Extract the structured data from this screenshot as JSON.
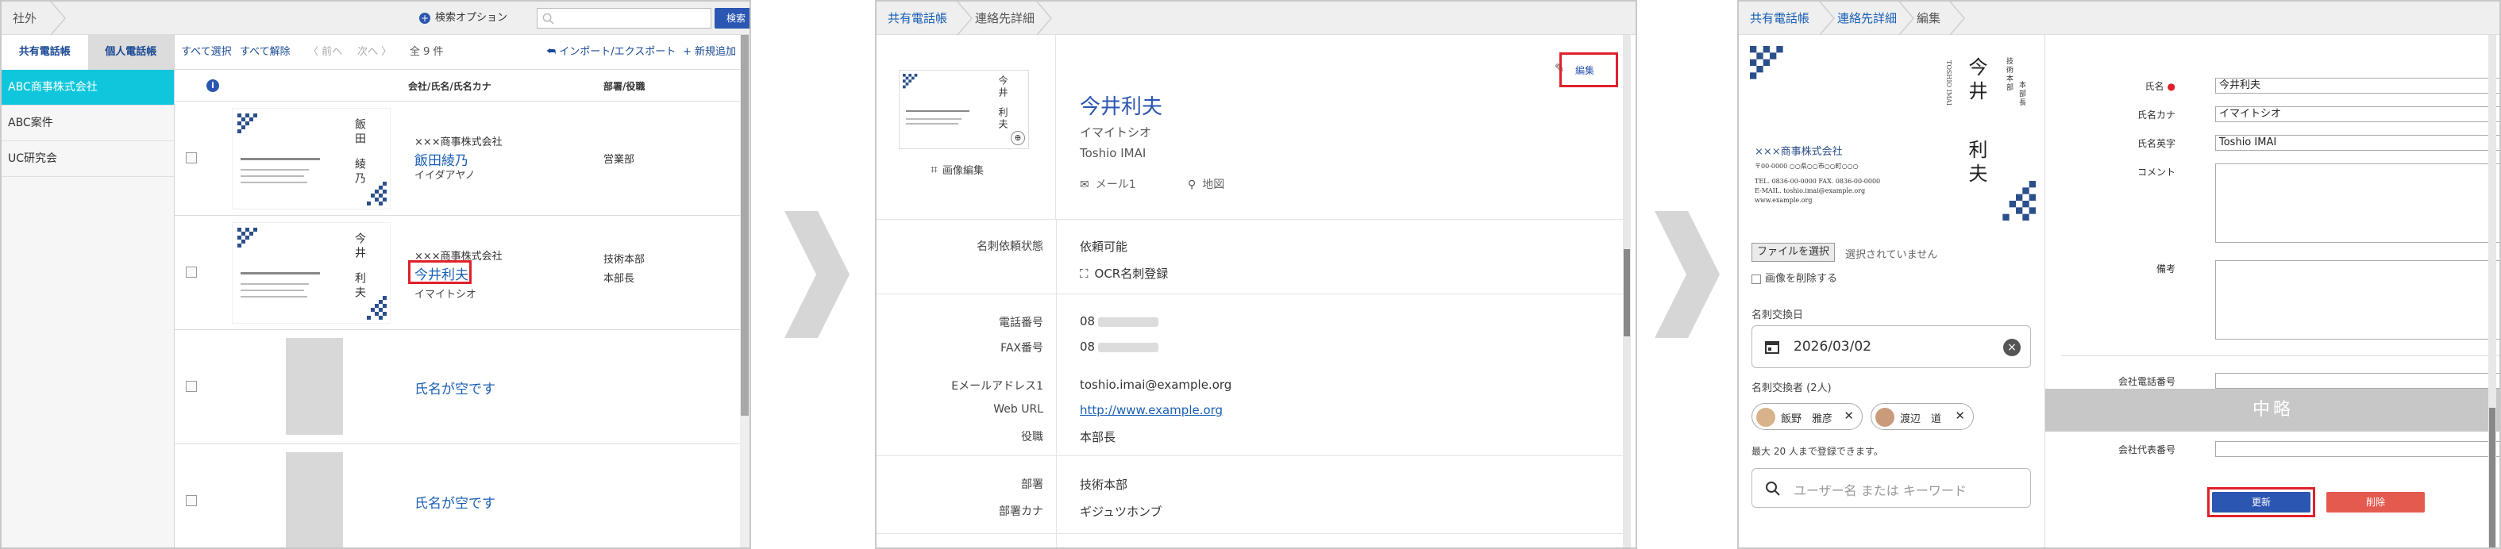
{
  "panel1": {
    "breadcrumb": "社外",
    "search_option": "検索オプション",
    "search_placeholder": "",
    "search_button": "検索",
    "tabs": [
      "共有電話帳",
      "個人電話帳"
    ],
    "sidebar_items": [
      "ABC商事株式会社",
      "ABC案件",
      "UC研究会"
    ],
    "toolbar": {
      "select_all": "すべて選択",
      "deselect_all": "すべて解除",
      "prev": "〈 前へ",
      "next": "次へ 〉",
      "count": "全 9 件",
      "import_export": "インポート/エクスポート",
      "new_add": "新規追加"
    },
    "columns": {
      "info": "i",
      "company_name": "会社/氏名/氏名カナ",
      "dept_title": "部署/役職"
    },
    "rows": [
      {
        "company": "×××商事株式会社",
        "name": "飯田綾乃",
        "kana": "イイダアヤノ",
        "dept": "営業部",
        "title": "",
        "card": {
          "sei": "飯田",
          "mei": "綾乃"
        }
      },
      {
        "company": "×××商事株式会社",
        "name": "今井利夫",
        "kana": "イマイトシオ",
        "dept": "技術本部",
        "title": "本部長",
        "card": {
          "sei": "今井",
          "mei": "利夫"
        }
      },
      {
        "company": "",
        "name": "氏名が空です",
        "kana": "",
        "dept": "",
        "title": ""
      },
      {
        "company": "",
        "name": "氏名が空です",
        "kana": "",
        "dept": "",
        "title": ""
      }
    ]
  },
  "panel2": {
    "breadcrumb": [
      "共有電話帳",
      "連絡先詳細"
    ],
    "image_edit": "画像編集",
    "edit": "編集",
    "name": "今井利夫",
    "kana": "イマイトシオ",
    "roman": "Toshio IMAI",
    "mail_link": "メール1",
    "map_link": "地図",
    "fields": [
      {
        "label": "名刺依頼状態",
        "value": "依頼可能"
      },
      {
        "label": "",
        "value": "OCR名刺登録"
      },
      {
        "label": "電話番号",
        "value": "08"
      },
      {
        "label": "FAX番号",
        "value": "08"
      },
      {
        "label": "Eメールアドレス1",
        "value": "toshio.imai@example.org"
      },
      {
        "label": "Web URL",
        "value": "http://www.example.org"
      },
      {
        "label": "役職",
        "value": "本部長"
      },
      {
        "label": "部署",
        "value": "技術本部"
      },
      {
        "label": "部署カナ",
        "value": "ギジュツホンブ"
      }
    ]
  },
  "panel3": {
    "breadcrumb": [
      "共有電話帳",
      "連絡先詳細",
      "編集"
    ],
    "card": {
      "company": "×××商事株式会社",
      "address": "〒00-0000 ○○県○○市○○町○○○",
      "tel": "TEL. 0836-00-0000   FAX. 0836-00-0000",
      "email": "E-MAIL. toshio.imai@example.org",
      "web": "www.example.org",
      "dept_lines": [
        "技術本部",
        "本部長"
      ],
      "roman_vertical": "TOSHIO IMAI",
      "sei": "今井",
      "mei": "利夫"
    },
    "file_button": "ファイルを選択",
    "file_status": "選択されていません",
    "delete_image": "画像を削除する",
    "exchange_date_label": "名刺交換日",
    "exchange_date": "2026/03/02",
    "exchangers_label": "名刺交換者 (2人)",
    "exchangers": [
      "飯野　雅彦",
      "渡辺　道"
    ],
    "max_note": "最大 20 人まで登録できます。",
    "user_placeholder": "ユーザー名 または キーワード",
    "form": {
      "name_label": "氏名",
      "name_value": "今井利夫",
      "kana_label": "氏名カナ",
      "kana_value": "イマイトシオ",
      "roman_label": "氏名英字",
      "roman_value": "Toshio IMAI",
      "comment_label": "コメント",
      "note_label": "備考",
      "company_tel_label": "会社電話番号",
      "omitted": "中略",
      "company_rep_label": "会社代表番号"
    },
    "update_button": "更新",
    "delete_button": "削除"
  }
}
